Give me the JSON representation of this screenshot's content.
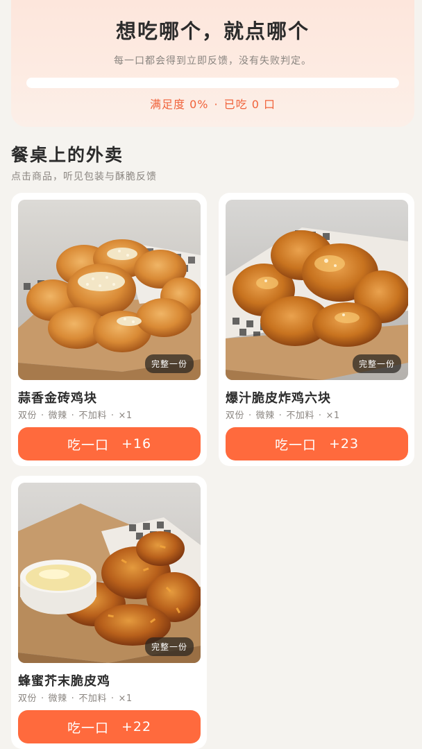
{
  "header": {
    "title": "想吃哪个，就点哪个",
    "subtitle": "每一口都会得到立即反馈，没有失败判定。",
    "satisfaction": {
      "label": "满足度 0%",
      "value_fraction": 0.0
    },
    "stats_separator": "·",
    "eaten_label": "已吃 0 口"
  },
  "section": {
    "title": "餐桌上的外卖",
    "subtitle": "点击商品，听见包装与酥脆反馈"
  },
  "colors": {
    "accent": "#ff6a3d",
    "accent_text": "#f0623a",
    "background": "#f5f3ef",
    "hero_bg": "#fde6dc"
  },
  "items": [
    {
      "name": "蒜香金砖鸡块",
      "portion_badge": "完整一份",
      "tags": [
        "双份",
        "微辣",
        "不加料",
        "×1"
      ],
      "button_label": "吃一口",
      "button_points": "+16",
      "image": "garlic-chicken-nuggets-photo"
    },
    {
      "name": "爆汁脆皮炸鸡六块",
      "portion_badge": "完整一份",
      "tags": [
        "双份",
        "微辣",
        "不加料",
        "×1"
      ],
      "button_label": "吃一口",
      "button_points": "+23",
      "image": "fried-chicken-six-pieces-photo"
    },
    {
      "name": "蜂蜜芥末脆皮鸡",
      "portion_badge": "完整一份",
      "tags": [
        "双份",
        "微辣",
        "不加料",
        "×1"
      ],
      "button_label": "吃一口",
      "button_points": "+22",
      "image": "honey-mustard-chicken-photo"
    }
  ]
}
